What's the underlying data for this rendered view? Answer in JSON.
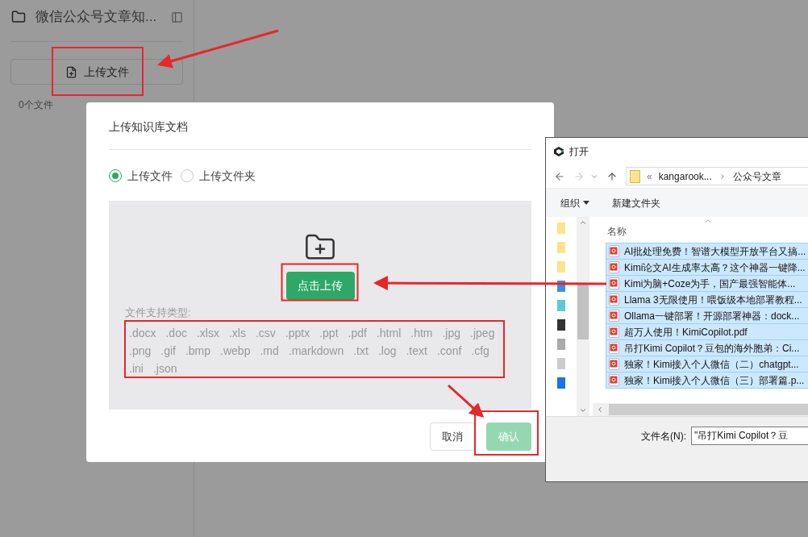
{
  "sidebar": {
    "title": "微信公众号文章知...",
    "upload_button": "上传文件",
    "file_count": "0个文件"
  },
  "modal": {
    "title": "上传知识库文档",
    "options": [
      {
        "label": "上传文件",
        "selected": true
      },
      {
        "label": "上传文件夹",
        "selected": false
      }
    ],
    "upload_button": "点击上传",
    "types_label": "文件支持类型:",
    "types": [
      ".docx",
      ".doc",
      ".xlsx",
      ".xls",
      ".csv",
      ".pptx",
      ".ppt",
      ".pdf",
      ".html",
      ".htm",
      ".jpg",
      ".jpeg",
      ".png",
      ".gif",
      ".bmp",
      ".webp",
      ".md",
      ".markdown",
      ".txt",
      ".log",
      ".text",
      ".conf",
      ".cfg",
      ".ini",
      ".json"
    ],
    "buttons": [
      {
        "label": "取消",
        "kind": "secondary",
        "disabled": false
      },
      {
        "label": "确认",
        "kind": "primary",
        "disabled": true
      }
    ]
  },
  "file_dialog": {
    "title": "打开",
    "path_overflow": "«",
    "path": [
      "kangarook...",
      "公众号文章"
    ],
    "toolbar": [
      "组织",
      "新建文件夹"
    ],
    "column": "名称",
    "files": [
      {
        "name": "AI批处理免费！智谱大模型开放平台又搞...",
        "selected": true
      },
      {
        "name": "Kimi论文AI生成率太高？这个神器一键降...",
        "selected": true
      },
      {
        "name": "Kimi为脑+Coze为手，国产最强智能体...",
        "selected": true
      },
      {
        "name": "Llama 3无限使用！喂饭级本地部署教程...",
        "selected": true
      },
      {
        "name": "Ollama一键部署！开源部署神器：dock...",
        "selected": true
      },
      {
        "name": "超万人使用！KimiCopilot.pdf",
        "selected": true
      },
      {
        "name": "吊打Kimi Copilot？豆包的海外胞弟：Ci...",
        "selected": true
      },
      {
        "name": "独家！Kimi接入个人微信（二）chatgpt...",
        "selected": true
      },
      {
        "name": "独家！Kimi接入个人微信（三）部署篇.p...",
        "selected": true
      }
    ],
    "filename_label": "文件名(N):",
    "filename_value": "\"吊打Kimi Copilot？豆"
  }
}
